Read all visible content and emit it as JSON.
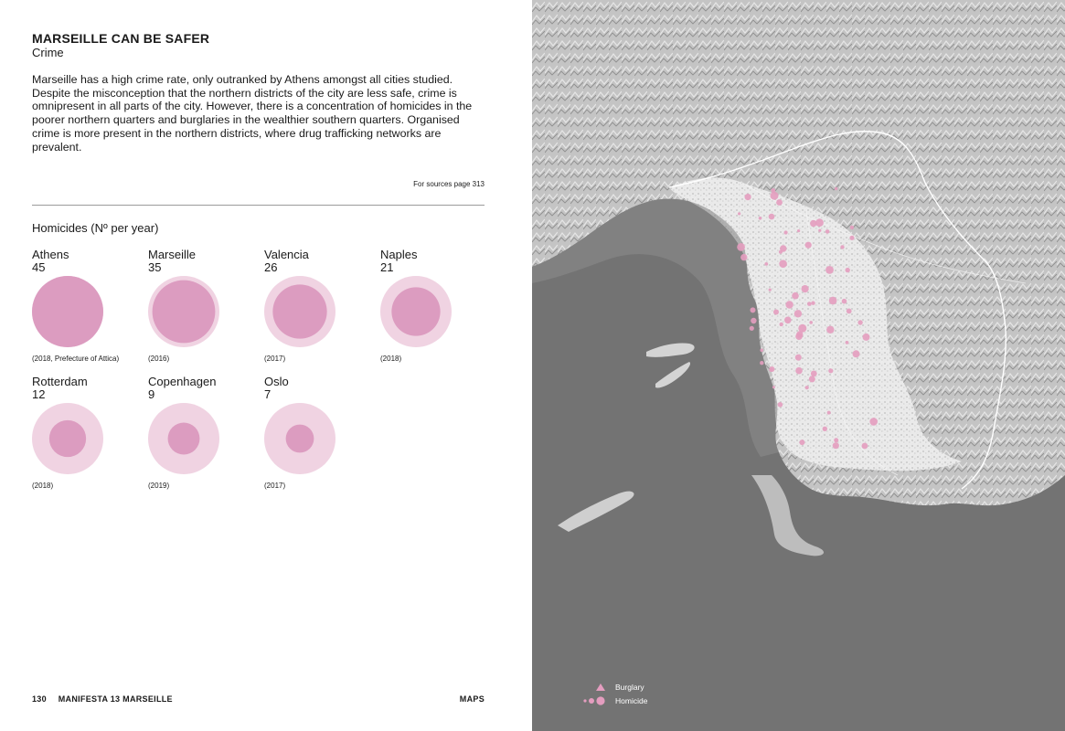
{
  "header": {
    "title": "MARSEILLE CAN BE SAFER",
    "subtitle": "Crime"
  },
  "intro": "Marseille has a high crime rate, only outranked by Athens amongst all cities studied. Despite the misconception that the northern districts of the city are less safe, crime is omnipresent in all parts of the city. However, there is a concentration of homicides in the poorer northern quarters and burglaries in the wealthier southern quarters. Organised crime is more present in the northern districts, where drug trafficking networks are prevalent.",
  "sources_note": "For sources page 313",
  "chart_data": {
    "type": "bubble",
    "title": "Homicides (Nº per year)",
    "max_value": 45,
    "colors": {
      "outer": "#f0d3e2",
      "inner": "#dc9cc0"
    },
    "items": [
      {
        "city": "Athens",
        "value": 45,
        "note": "(2018, Prefecture of Attica)"
      },
      {
        "city": "Marseille",
        "value": 35,
        "note": "(2016)"
      },
      {
        "city": "Valencia",
        "value": 26,
        "note": "(2017)"
      },
      {
        "city": "Naples",
        "value": 21,
        "note": "(2018)"
      },
      {
        "city": "Rotterdam",
        "value": 12,
        "note": "(2018)"
      },
      {
        "city": "Copenhagen",
        "value": 9,
        "note": "(2019)"
      },
      {
        "city": "Oslo",
        "value": 7,
        "note": "(2017)"
      }
    ]
  },
  "footer": {
    "page_number": "130",
    "publication": "MANIFESTA 13 MARSEILLE",
    "section": "MAPS"
  },
  "map": {
    "legend": [
      {
        "label": "Burglary",
        "symbol": "triangle-icon"
      },
      {
        "label": "Homicide",
        "symbol": "circles-icon"
      }
    ],
    "colors": {
      "sea": "#737373",
      "land": "#c6c6c6",
      "urban": "#e9e9e9",
      "point": "#e49dbf"
    }
  }
}
